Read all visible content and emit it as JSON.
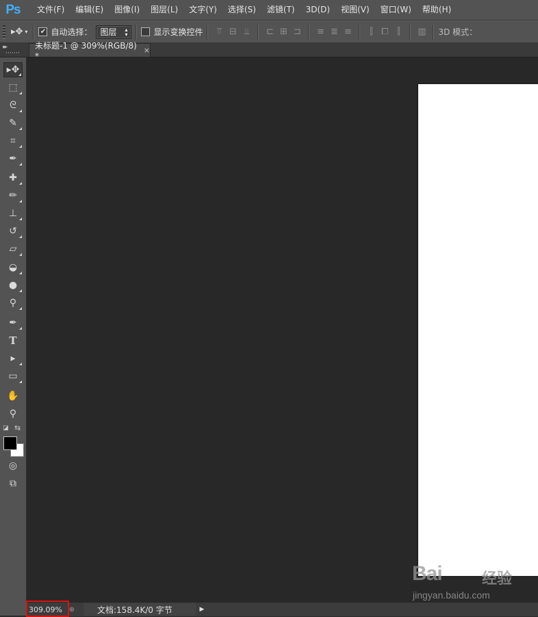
{
  "app": {
    "logo": "Ps"
  },
  "menu": [
    "文件(F)",
    "编辑(E)",
    "图像(I)",
    "图层(L)",
    "文字(Y)",
    "选择(S)",
    "滤镜(T)",
    "3D(D)",
    "视图(V)",
    "窗口(W)",
    "帮助(H)"
  ],
  "options": {
    "auto_select_label": "自动选择：",
    "auto_select_checked": true,
    "auto_select_value": "图层",
    "show_transform_label": "显示变换控件",
    "show_transform_checked": false,
    "mode_3d_label": "3D 模式："
  },
  "document": {
    "tab_title": "未标题-1 @ 309%(RGB/8) *",
    "close_glyph": "×"
  },
  "status": {
    "zoom": "309.09%",
    "doc_info": "文档:158.4K/0 字节"
  },
  "tools": [
    {
      "name": "move-tool",
      "glyph": "▸✥"
    },
    {
      "name": "rectangular-marquee-tool",
      "glyph": "⬚"
    },
    {
      "name": "lasso-tool",
      "glyph": "ᘓ"
    },
    {
      "name": "quick-selection-tool",
      "glyph": "✎"
    },
    {
      "name": "crop-tool",
      "glyph": "⌗"
    },
    {
      "name": "eyedropper-tool",
      "glyph": "✒"
    },
    {
      "name": "healing-brush-tool",
      "glyph": "✚"
    },
    {
      "name": "brush-tool",
      "glyph": "✏"
    },
    {
      "name": "clone-stamp-tool",
      "glyph": "⊥"
    },
    {
      "name": "history-brush-tool",
      "glyph": "↺"
    },
    {
      "name": "eraser-tool",
      "glyph": "▱"
    },
    {
      "name": "paint-bucket-tool",
      "glyph": "◒"
    },
    {
      "name": "blur-tool",
      "glyph": "●"
    },
    {
      "name": "dodge-tool",
      "glyph": "⚲"
    },
    {
      "name": "pen-tool",
      "glyph": "✒"
    },
    {
      "name": "type-tool",
      "glyph": "T"
    },
    {
      "name": "path-selection-tool",
      "glyph": "▸"
    },
    {
      "name": "shape-tool",
      "glyph": "▭"
    },
    {
      "name": "hand-tool",
      "glyph": "✋"
    },
    {
      "name": "zoom-tool",
      "glyph": "⚲"
    },
    {
      "name": "quick-mask-button",
      "glyph": "◎"
    },
    {
      "name": "screen-mode-button",
      "glyph": "⧉"
    }
  ],
  "colors": {
    "foreground": "#000000",
    "background": "#ffffff",
    "highlight": "#e01010"
  },
  "watermark": {
    "brand": "Bai",
    "cn": "经验",
    "url": "jingyan.baidu.com"
  }
}
